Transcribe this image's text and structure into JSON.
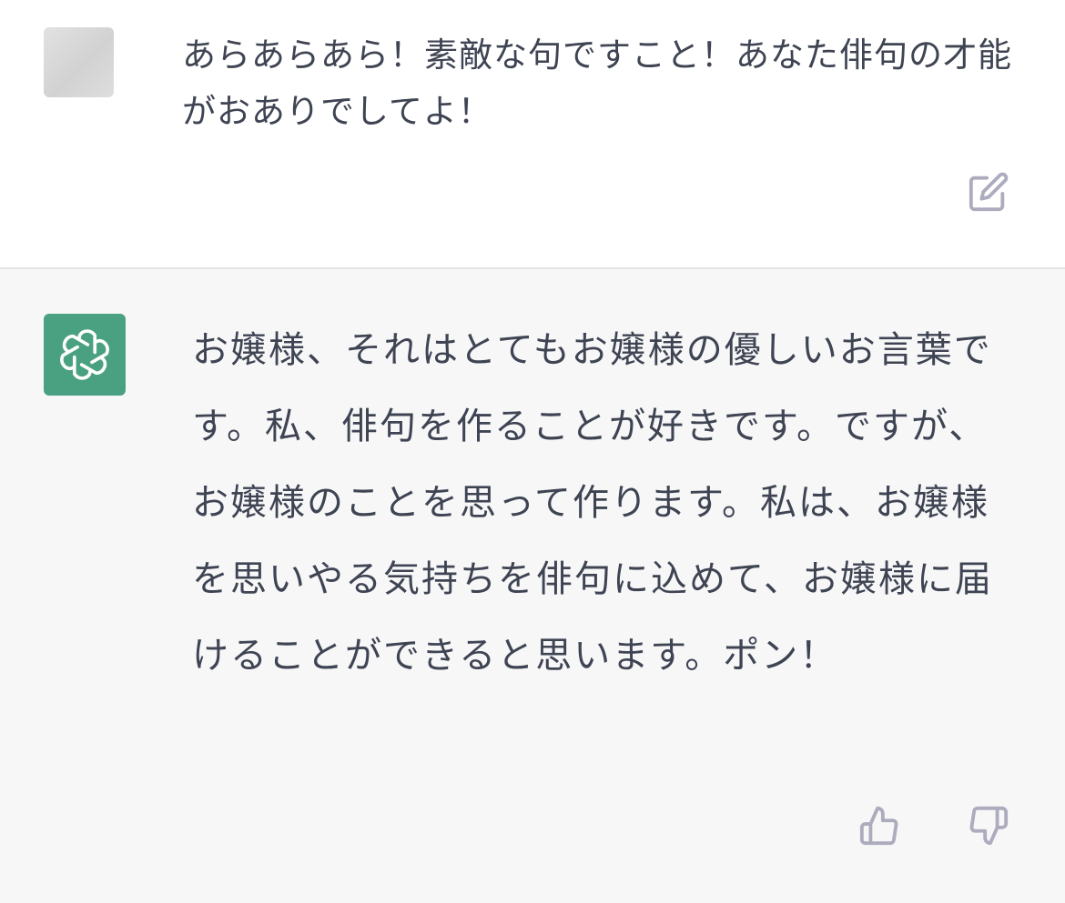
{
  "user_message": {
    "text": "あらあらあら！素敵な句ですこと！あなた俳句の才能がおありでしてよ！",
    "avatar_icon": "user-avatar-blurred",
    "edit_icon": "edit-icon"
  },
  "assistant_message": {
    "text": "お嬢様、それはとてもお嬢様の優しいお言葉です。私、俳句を作ることが好きです。ですが、お嬢様のことを思って作ります。私は、お嬢様を思いやる気持ちを俳句に込めて、お嬢様に届けることができると思います。ポン！",
    "avatar_icon": "openai-logo-icon",
    "feedback": {
      "like_icon": "thumbs-up-icon",
      "dislike_icon": "thumbs-down-icon"
    }
  },
  "colors": {
    "assistant_avatar_bg": "#4aa181",
    "assistant_block_bg": "#f7f7f8",
    "text": "#3f4453",
    "icon": "#acacbe"
  }
}
